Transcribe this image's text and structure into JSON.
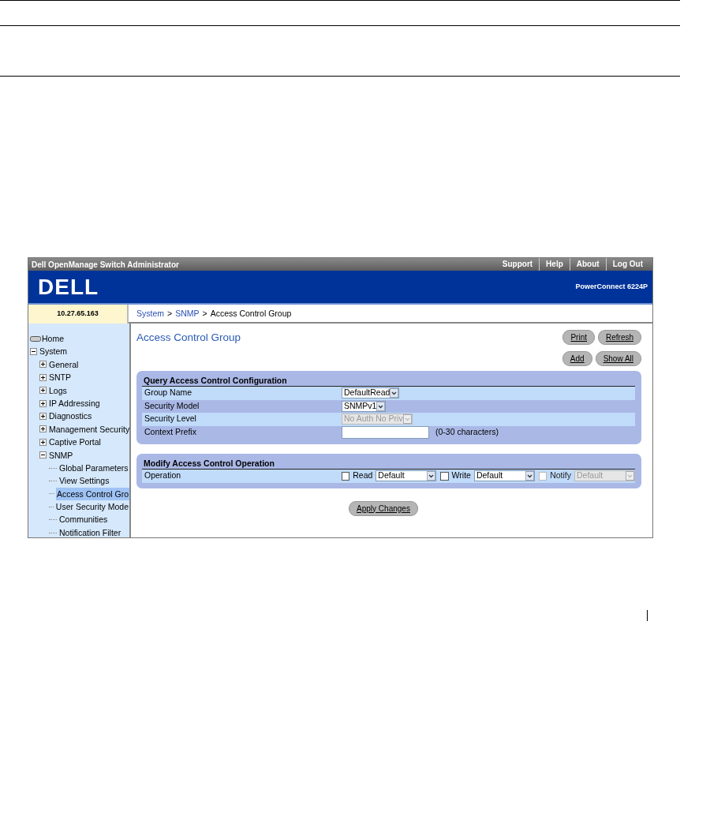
{
  "header": {
    "title": "Dell OpenManage Switch Administrator",
    "links": [
      "Support",
      "Help",
      "About",
      "Log Out"
    ]
  },
  "banner": {
    "logo": "DELL",
    "model": "PowerConnect 6224P"
  },
  "address": "10.27.65.163",
  "breadcrumb": {
    "separator": ">",
    "items": [
      {
        "label": "System",
        "link": true
      },
      {
        "label": "SNMP",
        "link": true
      },
      {
        "label": "Access Control Group",
        "link": false
      }
    ]
  },
  "sidebar": {
    "items": [
      {
        "label": "Home",
        "kind": "home"
      },
      {
        "label": "System",
        "kind": "folder",
        "expanded": true,
        "children": [
          {
            "label": "General",
            "kind": "folder",
            "expanded": false
          },
          {
            "label": "SNTP",
            "kind": "folder",
            "expanded": false
          },
          {
            "label": "Logs",
            "kind": "folder",
            "expanded": false
          },
          {
            "label": "IP Addressing",
            "kind": "folder",
            "expanded": false
          },
          {
            "label": "Diagnostics",
            "kind": "folder",
            "expanded": false
          },
          {
            "label": "Management Security",
            "kind": "folder",
            "expanded": false
          },
          {
            "label": "Captive Portal",
            "kind": "folder",
            "expanded": false
          },
          {
            "label": "SNMP",
            "kind": "folder",
            "expanded": true,
            "children": [
              {
                "label": "Global Parameters",
                "kind": "page",
                "selected": false
              },
              {
                "label": "View Settings",
                "kind": "page",
                "selected": false
              },
              {
                "label": "Access Control Gro",
                "kind": "page",
                "selected": true
              },
              {
                "label": "User Security Mode",
                "kind": "page",
                "selected": false
              },
              {
                "label": "Communities",
                "kind": "page",
                "selected": false
              },
              {
                "label": "Notification Filter",
                "kind": "page",
                "selected": false
              }
            ]
          }
        ]
      }
    ]
  },
  "page": {
    "title": "Access Control Group",
    "button_rows": [
      {
        "buttons": [
          "Print",
          "Refresh"
        ]
      },
      {
        "buttons": [
          "Add",
          "Show All"
        ]
      }
    ]
  },
  "query_panel": {
    "title": "Query Access Control Configuration",
    "rows": [
      {
        "label": "Group Name",
        "kind": "select",
        "value": "DefaultRead",
        "disabled": false
      },
      {
        "label": "Security Model",
        "kind": "select",
        "value": "SNMPv1",
        "disabled": false
      },
      {
        "label": "Security Level",
        "kind": "select",
        "value": "No Auth No Priv",
        "disabled": true
      },
      {
        "label": "Context Prefix",
        "kind": "text",
        "note": "(0-30 characters)"
      }
    ]
  },
  "operation_panel": {
    "title": "Modify Access Control Operation",
    "label": "Operation",
    "options": [
      {
        "label": "Read",
        "checked": false,
        "value": "Default",
        "disabled": false
      },
      {
        "label": "Write",
        "checked": false,
        "value": "Default",
        "disabled": false
      },
      {
        "label": "Notify",
        "checked": false,
        "value": "Default",
        "disabled": true
      }
    ]
  },
  "apply_button": "Apply Changes"
}
